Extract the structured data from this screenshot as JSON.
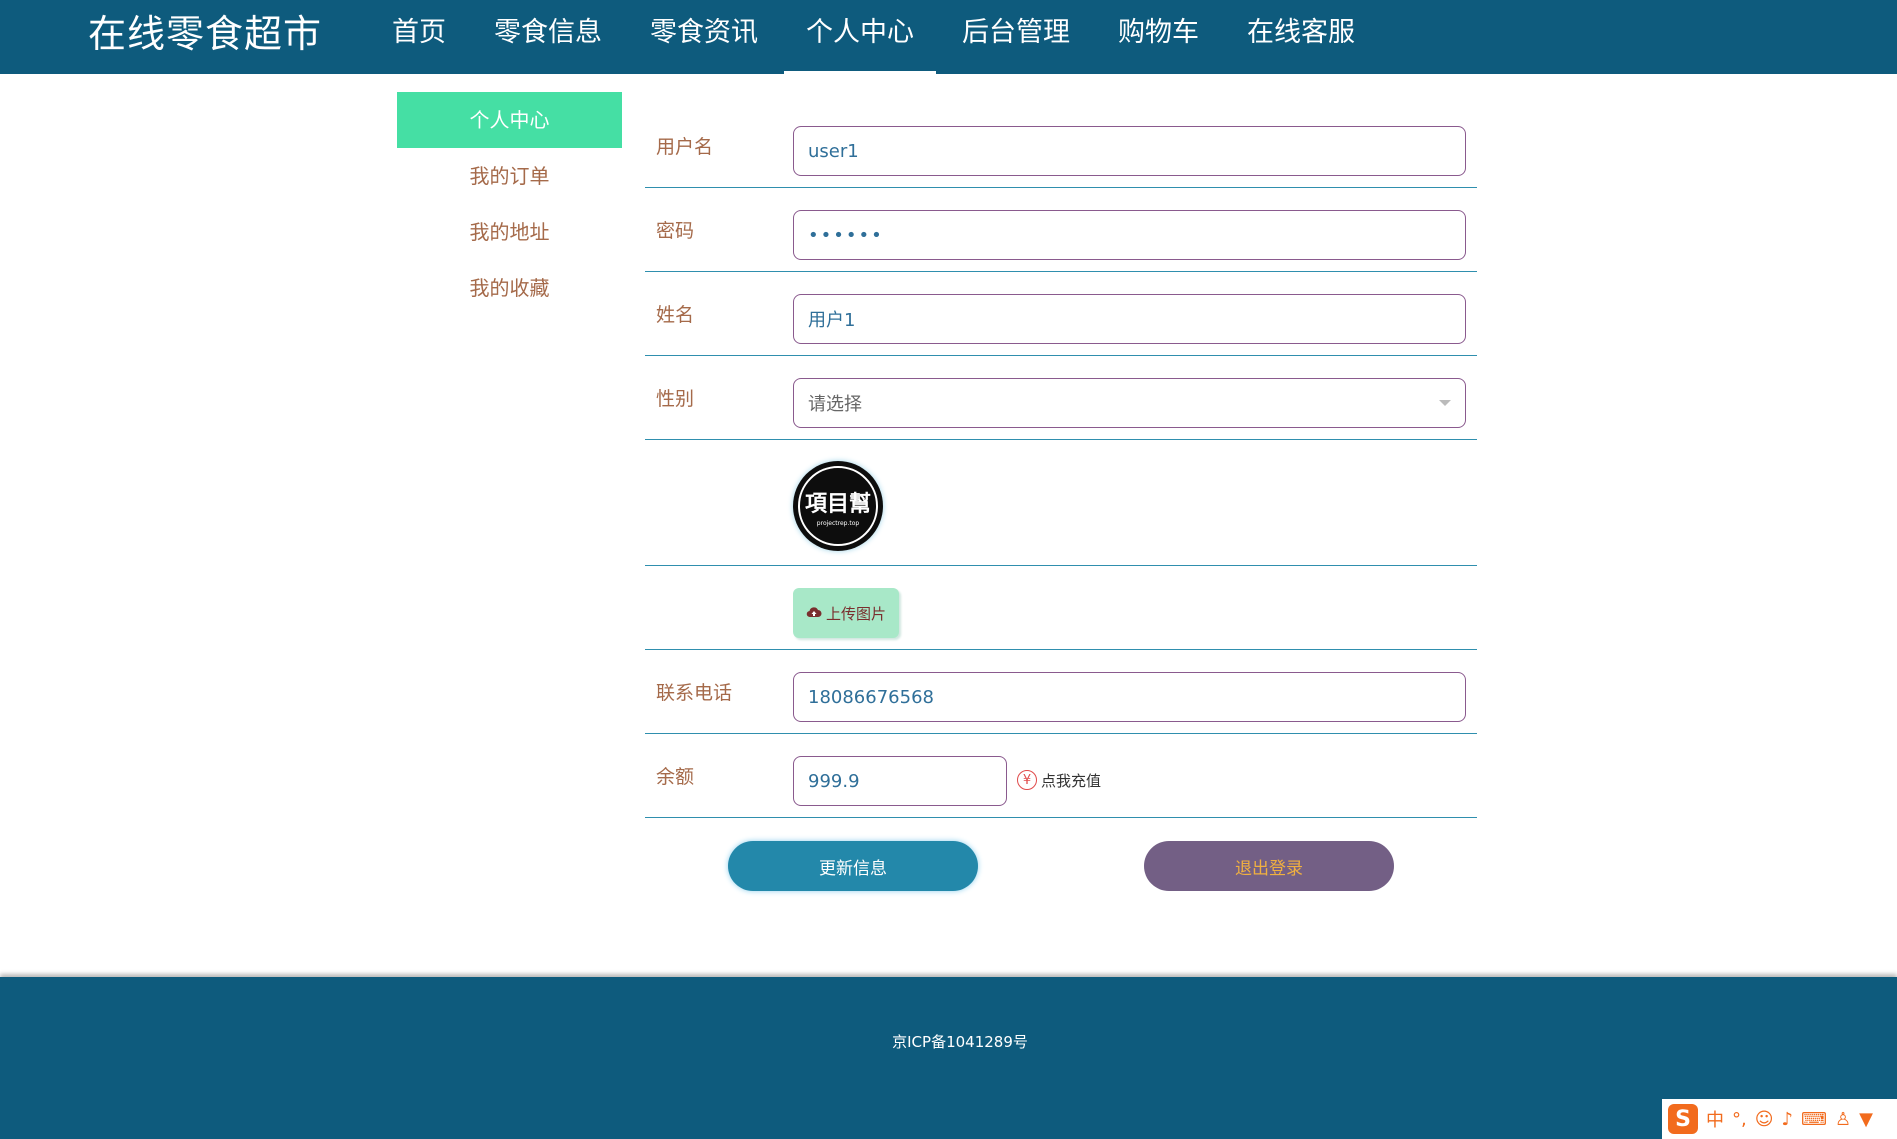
{
  "header": {
    "brand": "在线零食超市",
    "nav": [
      "首页",
      "零食信息",
      "零食资讯",
      "个人中心",
      "后台管理",
      "购物车",
      "在线客服"
    ],
    "active_nav": "个人中心"
  },
  "sidebar": {
    "items": [
      "个人中心",
      "我的订单",
      "我的地址",
      "我的收藏"
    ],
    "active": "个人中心"
  },
  "form": {
    "username_label": "用户名",
    "username_value": "user1",
    "password_label": "密码",
    "password_value": "••••••",
    "name_label": "姓名",
    "name_value": "用户1",
    "gender_label": "性别",
    "gender_placeholder": "请选择",
    "avatar_text": "項目幫",
    "avatar_subtext": "projectrep.top",
    "upload_label": "上传图片",
    "phone_label": "联系电话",
    "phone_value": "18086676568",
    "balance_label": "余额",
    "balance_value": "999.9",
    "recharge_label": "点我充值",
    "recharge_icon": "¥",
    "update_button": "更新信息",
    "logout_button": "退出登录"
  },
  "footer": {
    "icp": "京ICP备1041289号"
  },
  "ime": {
    "logo": "S",
    "lang": "中"
  },
  "colors": {
    "nav_bg": "#0e5b7d",
    "side_active": "#45dfa4",
    "label": "#a56a4a",
    "update_btn": "#2388aa",
    "logout_btn": "#735f85"
  }
}
